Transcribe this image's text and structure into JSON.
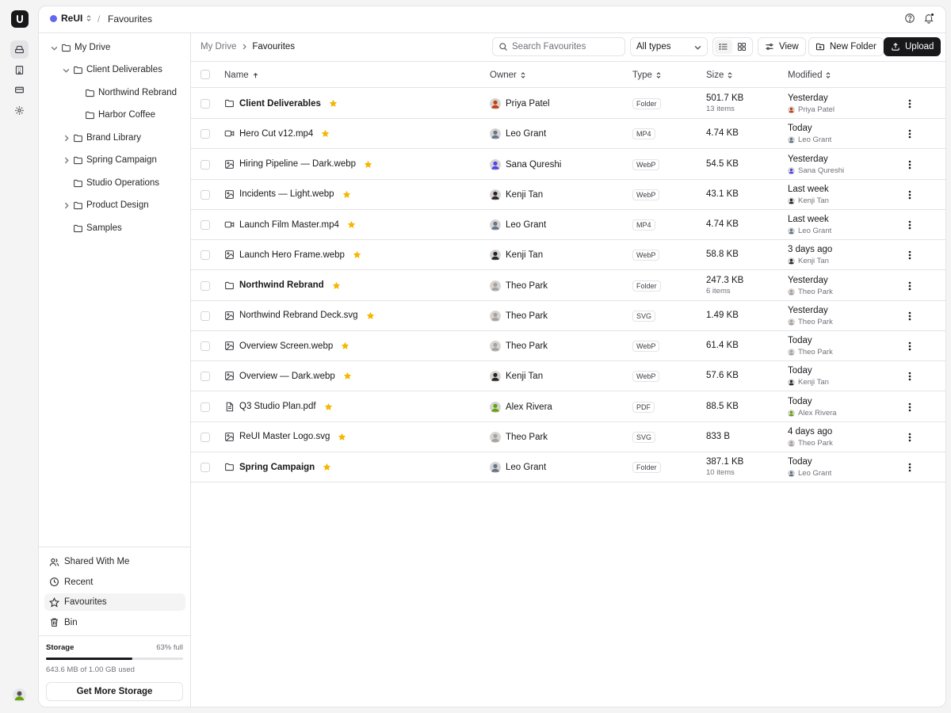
{
  "workspace": {
    "name": "ReUI",
    "accent": "#6366f1"
  },
  "top_title": "Favourites",
  "sidebar": {
    "tree": [
      {
        "label": "My Drive",
        "level": 0,
        "expanded": true,
        "chevron": true
      },
      {
        "label": "Client Deliverables",
        "level": 1,
        "expanded": true,
        "chevron": true
      },
      {
        "label": "Northwind Rebrand",
        "level": 2,
        "chevron": false
      },
      {
        "label": "Harbor Coffee",
        "level": 2,
        "chevron": false
      },
      {
        "label": "Brand Library",
        "level": 1,
        "expanded": false,
        "chevron": true
      },
      {
        "label": "Spring Campaign",
        "level": 1,
        "expanded": false,
        "chevron": true
      },
      {
        "label": "Studio Operations",
        "level": 1,
        "chevron": false
      },
      {
        "label": "Product Design",
        "level": 1,
        "expanded": false,
        "chevron": true
      },
      {
        "label": "Samples",
        "level": 1,
        "chevron": false
      }
    ],
    "nav": [
      {
        "label": "Shared With Me",
        "icon": "users-icon",
        "active": false
      },
      {
        "label": "Recent",
        "icon": "clock-icon",
        "active": false
      },
      {
        "label": "Favourites",
        "icon": "star-icon",
        "active": true
      },
      {
        "label": "Bin",
        "icon": "trash-icon",
        "active": false
      }
    ],
    "storage": {
      "label": "Storage",
      "percent_text": "63% full",
      "fraction": 0.63,
      "used_text": "643.6 MB of 1.00 GB used",
      "button": "Get More Storage"
    }
  },
  "breadcrumb": [
    "My Drive",
    "Favourites"
  ],
  "toolbar": {
    "search_placeholder": "Search Favourites",
    "filter_value": "All types",
    "view_label": "View",
    "new_folder_label": "New Folder",
    "upload_label": "Upload"
  },
  "table": {
    "columns": {
      "name": "Name",
      "owner": "Owner",
      "type": "Type",
      "size": "Size",
      "modified": "Modified"
    },
    "rows": [
      {
        "name": "Client Deliverables",
        "kind": "folder",
        "owner": "Priya Patel",
        "owner_color": "#c2410c",
        "type": "Folder",
        "size": "501.7 KB",
        "items": "13 items",
        "modified": "Yesterday",
        "modified_by": "Priya Patel"
      },
      {
        "name": "Hero Cut v12.mp4",
        "kind": "video",
        "owner": "Leo Grant",
        "owner_color": "#64748b",
        "type": "MP4",
        "size": "4.74 KB",
        "items": "",
        "modified": "Today",
        "modified_by": "Leo Grant"
      },
      {
        "name": "Hiring Pipeline — Dark.webp",
        "kind": "image",
        "owner": "Sana Qureshi",
        "owner_color": "#4f46e5",
        "type": "WebP",
        "size": "54.5 KB",
        "items": "",
        "modified": "Yesterday",
        "modified_by": "Sana Qureshi"
      },
      {
        "name": "Incidents — Light.webp",
        "kind": "image",
        "owner": "Kenji Tan",
        "owner_color": "#292524",
        "type": "WebP",
        "size": "43.1 KB",
        "items": "",
        "modified": "Last week",
        "modified_by": "Kenji Tan"
      },
      {
        "name": "Launch Film Master.mp4",
        "kind": "video",
        "owner": "Leo Grant",
        "owner_color": "#64748b",
        "type": "MP4",
        "size": "4.74 KB",
        "items": "",
        "modified": "Last week",
        "modified_by": "Leo Grant"
      },
      {
        "name": "Launch Hero Frame.webp",
        "kind": "image",
        "owner": "Kenji Tan",
        "owner_color": "#292524",
        "type": "WebP",
        "size": "58.8 KB",
        "items": "",
        "modified": "3 days ago",
        "modified_by": "Kenji Tan"
      },
      {
        "name": "Northwind Rebrand",
        "kind": "folder",
        "owner": "Theo Park",
        "owner_color": "#a8a29e",
        "type": "Folder",
        "size": "247.3 KB",
        "items": "6 items",
        "modified": "Yesterday",
        "modified_by": "Theo Park"
      },
      {
        "name": "Northwind Rebrand Deck.svg",
        "kind": "image",
        "owner": "Theo Park",
        "owner_color": "#a8a29e",
        "type": "SVG",
        "size": "1.49 KB",
        "items": "",
        "modified": "Yesterday",
        "modified_by": "Theo Park"
      },
      {
        "name": "Overview Screen.webp",
        "kind": "image",
        "owner": "Theo Park",
        "owner_color": "#a8a29e",
        "type": "WebP",
        "size": "61.4 KB",
        "items": "",
        "modified": "Today",
        "modified_by": "Theo Park"
      },
      {
        "name": "Overview — Dark.webp",
        "kind": "image",
        "owner": "Kenji Tan",
        "owner_color": "#292524",
        "type": "WebP",
        "size": "57.6 KB",
        "items": "",
        "modified": "Today",
        "modified_by": "Kenji Tan"
      },
      {
        "name": "Q3 Studio Plan.pdf",
        "kind": "doc",
        "owner": "Alex Rivera",
        "owner_color": "#65a30d",
        "type": "PDF",
        "size": "88.5 KB",
        "items": "",
        "modified": "Today",
        "modified_by": "Alex Rivera"
      },
      {
        "name": "ReUI Master Logo.svg",
        "kind": "image",
        "owner": "Theo Park",
        "owner_color": "#a8a29e",
        "type": "SVG",
        "size": "833 B",
        "items": "",
        "modified": "4 days ago",
        "modified_by": "Theo Park"
      },
      {
        "name": "Spring Campaign",
        "kind": "folder",
        "owner": "Leo Grant",
        "owner_color": "#64748b",
        "type": "Folder",
        "size": "387.1 KB",
        "items": "10 items",
        "modified": "Today",
        "modified_by": "Leo Grant"
      }
    ]
  }
}
